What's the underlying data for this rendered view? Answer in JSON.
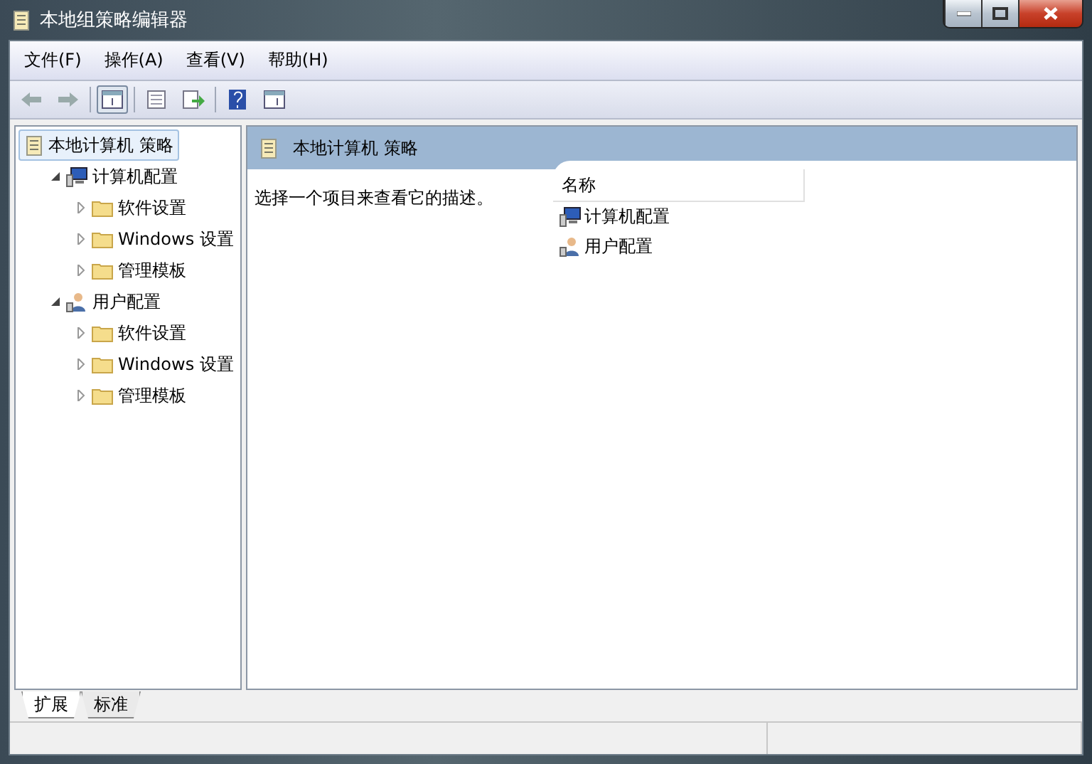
{
  "window": {
    "title": "本地组策略编辑器"
  },
  "menu": [
    "文件(F)",
    "操作(A)",
    "查看(V)",
    "帮助(H)"
  ],
  "tree": [
    {
      "label": "本地计算机 策略",
      "kind": "policy",
      "selected": true,
      "children": [
        {
          "label": "计算机配置",
          "kind": "computer",
          "selected": false,
          "expanded": true,
          "children": [
            {
              "label": "软件设置",
              "kind": "folder",
              "selected": false,
              "expanded": false
            },
            {
              "label": "Windows 设置",
              "kind": "folder",
              "selected": false,
              "expanded": false
            },
            {
              "label": "管理模板",
              "kind": "folder",
              "selected": false,
              "expanded": false
            }
          ]
        },
        {
          "label": "用户配置",
          "kind": "user",
          "selected": false,
          "expanded": true,
          "children": [
            {
              "label": "软件设置",
              "kind": "folder",
              "selected": false,
              "expanded": false
            },
            {
              "label": "Windows 设置",
              "kind": "folder",
              "selected": false,
              "expanded": false
            },
            {
              "label": "管理模板",
              "kind": "folder",
              "selected": false,
              "expanded": false
            }
          ]
        }
      ]
    }
  ],
  "detail": {
    "title": "本地计算机 策略",
    "description": "选择一个项目来查看它的描述。",
    "columns": [
      "名称"
    ],
    "rows": [
      {
        "label": "计算机配置",
        "kind": "computer"
      },
      {
        "label": "用户配置",
        "kind": "user"
      }
    ]
  },
  "tabs": [
    {
      "label": "扩展",
      "selected": true
    },
    {
      "label": "标准",
      "selected": false
    }
  ]
}
